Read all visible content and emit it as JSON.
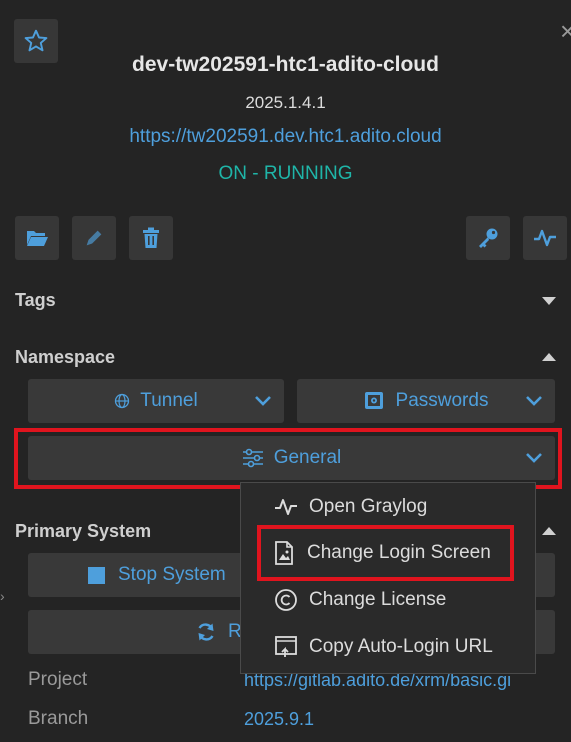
{
  "header": {
    "title": "dev-tw202591-htc1-adito-cloud",
    "version": "2025.1.4.1",
    "url": "https://tw202591.dev.htc1.adito.cloud",
    "status": "ON - RUNNING",
    "close_glyph": "×"
  },
  "actions": {
    "left": [
      "folder-open-icon",
      "pencil-icon",
      "trash-icon"
    ],
    "right": [
      "key-icon",
      "activity-icon"
    ]
  },
  "sections": {
    "tags": "Tags",
    "namespace": "Namespace",
    "primary_system": "Primary System"
  },
  "namespace": {
    "tunnel": "Tunnel",
    "passwords": "Passwords",
    "general": "General"
  },
  "general_menu": {
    "items": [
      {
        "label": "Open Graylog",
        "icon": "activity-icon"
      },
      {
        "label": "Change Login Screen",
        "icon": "image-file-icon"
      },
      {
        "label": "Change License",
        "icon": "copyright-icon"
      },
      {
        "label": "Copy Auto-Login URL",
        "icon": "copy-url-icon"
      }
    ]
  },
  "primary_system": {
    "stop_label": "Stop System",
    "restart_label_partial": "R"
  },
  "details": {
    "project_label": "Project",
    "project_value": "https://gitlab.adito.de/xrm/basic.gi",
    "branch_label": "Branch",
    "branch_value": "2025.9.1"
  },
  "colors": {
    "accent": "#4e9fdc",
    "status_running": "#1fb5a8",
    "highlight_red": "#e0141e",
    "background": "#242424"
  }
}
